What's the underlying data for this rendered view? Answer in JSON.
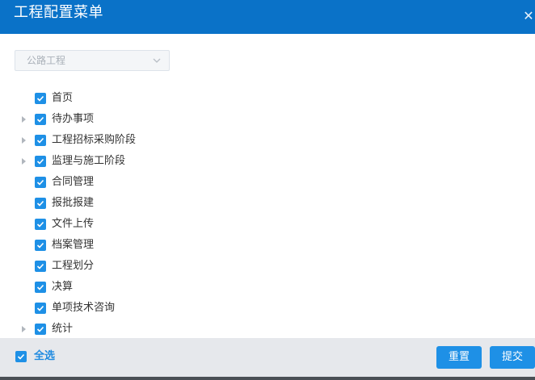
{
  "dialog": {
    "title": "工程配置菜单"
  },
  "icons": {
    "close": "close-icon",
    "dropdown": "chevron-down-icon",
    "expand": "caret-right-icon",
    "check": "checkbox-check-icon"
  },
  "colors": {
    "header": "#0a72c8",
    "accent": "#1e90e6",
    "footer": "#e6e8ec"
  },
  "project_select": {
    "value": "公路工程",
    "disabled": true
  },
  "tree": {
    "items": [
      {
        "label": "首页",
        "checked": true,
        "expandable": false
      },
      {
        "label": "待办事项",
        "checked": true,
        "expandable": true
      },
      {
        "label": "工程招标采购阶段",
        "checked": true,
        "expandable": true
      },
      {
        "label": "监理与施工阶段",
        "checked": true,
        "expandable": true
      },
      {
        "label": "合同管理",
        "checked": true,
        "expandable": false
      },
      {
        "label": "报批报建",
        "checked": true,
        "expandable": false
      },
      {
        "label": "文件上传",
        "checked": true,
        "expandable": false
      },
      {
        "label": "档案管理",
        "checked": true,
        "expandable": false
      },
      {
        "label": "工程划分",
        "checked": true,
        "expandable": false
      },
      {
        "label": "决算",
        "checked": true,
        "expandable": false
      },
      {
        "label": "单项技术咨询",
        "checked": true,
        "expandable": false
      },
      {
        "label": "统计",
        "checked": true,
        "expandable": true
      }
    ]
  },
  "footer": {
    "select_all_label": "全选",
    "select_all_checked": true,
    "reset_label": "重置",
    "submit_label": "提交"
  }
}
